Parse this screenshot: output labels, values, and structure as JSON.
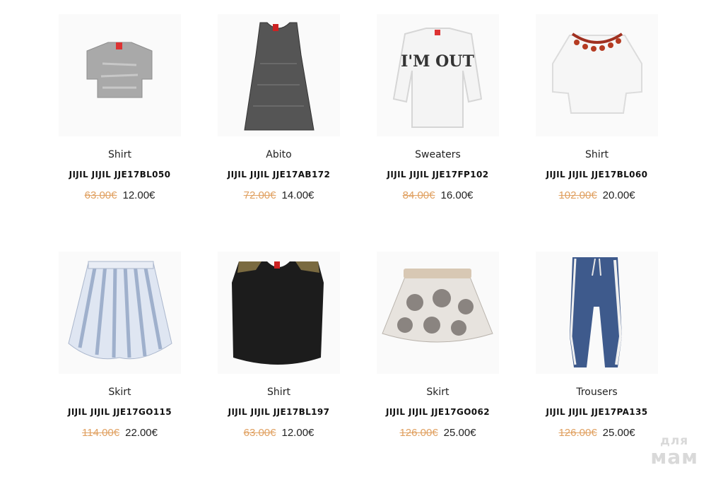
{
  "products": [
    {
      "category": "Shirt",
      "name": "JIJIL JIJIL JJE17BL050",
      "old_price": "63.00€",
      "new_price": "12.00€",
      "image": "grey-crop-top"
    },
    {
      "category": "Abito",
      "name": "JIJIL JIJIL JJE17AB172",
      "old_price": "72.00€",
      "new_price": "14.00€",
      "image": "dark-grey-sleeveless-dress"
    },
    {
      "category": "Sweaters",
      "name": "JIJIL JIJIL JJE17FP102",
      "old_price": "84.00€",
      "new_price": "16.00€",
      "image": "white-sweatshirt",
      "print_text": "I'M OUT"
    },
    {
      "category": "Shirt",
      "name": "JIJIL JIJIL JJE17BL060",
      "old_price": "102.00€",
      "new_price": "20.00€",
      "image": "white-blouse-tassels"
    },
    {
      "category": "Skirt",
      "name": "JIJIL JIJIL JJE17GO115",
      "old_price": "114.00€",
      "new_price": "22.00€",
      "image": "striped-skirt"
    },
    {
      "category": "Shirt",
      "name": "JIJIL JIJIL JJE17BL197",
      "old_price": "63.00€",
      "new_price": "12.00€",
      "image": "black-sleeveless-top"
    },
    {
      "category": "Skirt",
      "name": "JIJIL JIJIL JJE17GO062",
      "old_price": "126.00€",
      "new_price": "25.00€",
      "image": "floral-skirt"
    },
    {
      "category": "Trousers",
      "name": "JIJIL JIJIL JJE17PA135",
      "old_price": "126.00€",
      "new_price": "25.00€",
      "image": "blue-trousers"
    }
  ],
  "watermark": {
    "line1": "для",
    "line2": "мам"
  },
  "colors": {
    "old_price": "#e0a060",
    "text": "#222222"
  }
}
